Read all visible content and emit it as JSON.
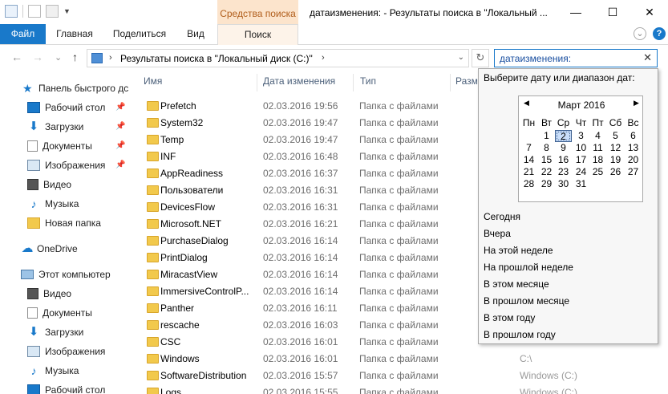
{
  "titlebar": {
    "context_tab_group": "Средства поиска",
    "window_title": "датаизменения: - Результаты поиска в \"Локальный ...",
    "minimize": "—",
    "maximize": "☐",
    "close": "✕"
  },
  "ribbon": {
    "tabs": [
      "Файл",
      "Главная",
      "Поделиться",
      "Вид",
      "Поиск"
    ],
    "help_glyph": "?",
    "collapse_glyph": "⌄"
  },
  "address": {
    "back": "←",
    "forward": "→",
    "recent": "⌄",
    "up": "↑",
    "path": "Результаты поиска в \"Локальный диск (C:)\"",
    "sep_chevron": "›",
    "dropdown": "⌄",
    "refresh": "↻",
    "search_value": "датаизменения:",
    "clear": "✕"
  },
  "nav": {
    "quick_access": "Панель быстрого дс",
    "items": [
      {
        "label": "Рабочий стол",
        "icon": "desktop-icon",
        "pinned": true
      },
      {
        "label": "Загрузки",
        "icon": "download-icon",
        "pinned": true
      },
      {
        "label": "Документы",
        "icon": "documents-icon",
        "pinned": true
      },
      {
        "label": "Изображения",
        "icon": "pictures-icon",
        "pinned": true
      },
      {
        "label": "Видео",
        "icon": "video-icon",
        "pinned": false
      },
      {
        "label": "Музыка",
        "icon": "music-icon",
        "pinned": false
      },
      {
        "label": "Новая папка",
        "icon": "folder-icon",
        "pinned": false
      }
    ],
    "onedrive": "OneDrive",
    "this_pc": "Этот компьютер",
    "pc_items": [
      {
        "label": "Видео",
        "icon": "video-icon"
      },
      {
        "label": "Документы",
        "icon": "documents-icon"
      },
      {
        "label": "Загрузки",
        "icon": "download-icon"
      },
      {
        "label": "Изображения",
        "icon": "pictures-icon"
      },
      {
        "label": "Музыка",
        "icon": "music-icon"
      },
      {
        "label": "Рабочий стол",
        "icon": "desktop-icon"
      }
    ],
    "pin_glyph": "📌"
  },
  "columns": {
    "name": "Имя",
    "date": "Дата изменения",
    "type": "Тип",
    "size": "Разм"
  },
  "files": [
    {
      "name": "Prefetch",
      "date": "02.03.2016 19:56",
      "type": "Папка с файлами"
    },
    {
      "name": "System32",
      "date": "02.03.2016 19:47",
      "type": "Папка с файлами"
    },
    {
      "name": "Temp",
      "date": "02.03.2016 19:47",
      "type": "Папка с файлами"
    },
    {
      "name": "INF",
      "date": "02.03.2016 16:48",
      "type": "Папка с файлами"
    },
    {
      "name": "AppReadiness",
      "date": "02.03.2016 16:37",
      "type": "Папка с файлами"
    },
    {
      "name": "Пользователи",
      "date": "02.03.2016 16:31",
      "type": "Папка с файлами"
    },
    {
      "name": "DevicesFlow",
      "date": "02.03.2016 16:31",
      "type": "Папка с файлами"
    },
    {
      "name": "Microsoft.NET",
      "date": "02.03.2016 16:21",
      "type": "Папка с файлами"
    },
    {
      "name": "PurchaseDialog",
      "date": "02.03.2016 16:14",
      "type": "Папка с файлами"
    },
    {
      "name": "PrintDialog",
      "date": "02.03.2016 16:14",
      "type": "Папка с файлами"
    },
    {
      "name": "MiracastView",
      "date": "02.03.2016 16:14",
      "type": "Папка с файлами"
    },
    {
      "name": "ImmersiveControlP...",
      "date": "02.03.2016 16:14",
      "type": "Папка с файлами"
    },
    {
      "name": "Panther",
      "date": "02.03.2016 16:11",
      "type": "Папка с файлами"
    },
    {
      "name": "rescache",
      "date": "02.03.2016 16:03",
      "type": "Папка с файлами"
    },
    {
      "name": "CSC",
      "date": "02.03.2016 16:01",
      "type": "Папка с файлами"
    },
    {
      "name": "Windows",
      "date": "02.03.2016 16:01",
      "type": "Папка с файлами"
    },
    {
      "name": "SoftwareDistribution",
      "date": "02.03.2016 15:57",
      "type": "Папка с файлами"
    },
    {
      "name": "Logs",
      "date": "02.03.2016 15:55",
      "type": "Папка с файлами"
    }
  ],
  "locations_visible": [
    {
      "row": 15,
      "text": "C:\\"
    },
    {
      "row": 16,
      "text": "Windows (C:)"
    },
    {
      "row": 17,
      "text": "Windows (C:)"
    }
  ],
  "date_picker": {
    "prompt": "Выберите дату или диапазон дат:",
    "month": "Март 2016",
    "prev": "◀",
    "next": "▶",
    "weekdays": [
      "Пн",
      "Вт",
      "Ср",
      "Чт",
      "Пт",
      "Сб",
      "Вс"
    ],
    "weeks": [
      [
        "",
        "1",
        "2",
        "3",
        "4",
        "5",
        "6"
      ],
      [
        "7",
        "8",
        "9",
        "10",
        "11",
        "12",
        "13"
      ],
      [
        "14",
        "15",
        "16",
        "17",
        "18",
        "19",
        "20"
      ],
      [
        "21",
        "22",
        "23",
        "24",
        "25",
        "26",
        "27"
      ],
      [
        "28",
        "29",
        "30",
        "31",
        "",
        "",
        ""
      ]
    ],
    "selected_day": "2",
    "options": [
      "Сегодня",
      "Вчера",
      "На этой неделе",
      "На прошлой неделе",
      "В этом месяце",
      "В прошлом месяце",
      "В этом году",
      "В прошлом году"
    ]
  },
  "colors": {
    "accent": "#1979ca",
    "context_tab": "#fce4cc",
    "folder": "#f2c94c"
  }
}
